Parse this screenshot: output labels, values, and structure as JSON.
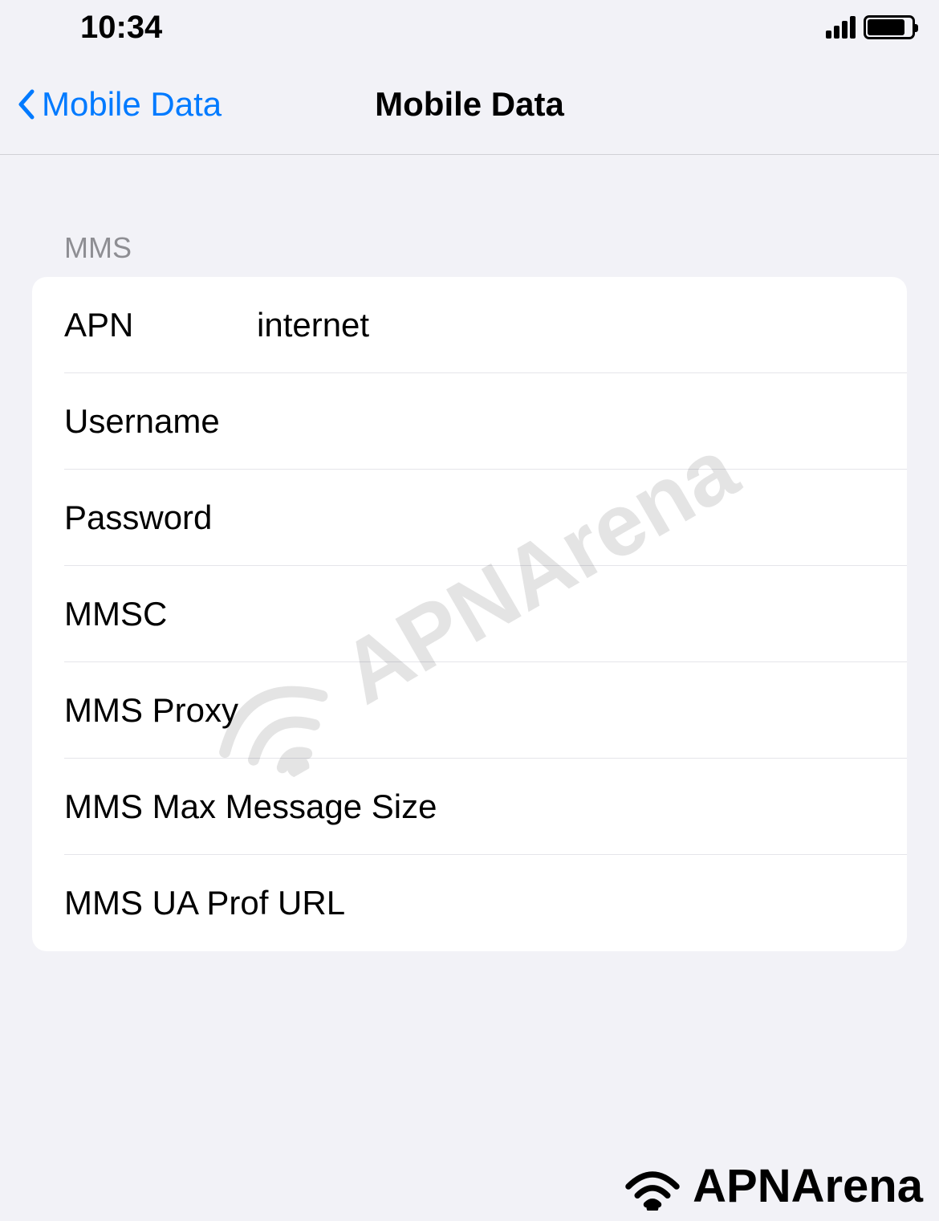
{
  "statusBar": {
    "time": "10:34"
  },
  "nav": {
    "backLabel": "Mobile Data",
    "title": "Mobile Data"
  },
  "section": {
    "header": "MMS",
    "rows": [
      {
        "label": "APN",
        "value": "internet"
      },
      {
        "label": "Username",
        "value": ""
      },
      {
        "label": "Password",
        "value": ""
      },
      {
        "label": "MMSC",
        "value": ""
      },
      {
        "label": "MMS Proxy",
        "value": ""
      },
      {
        "label": "MMS Max Message Size",
        "value": ""
      },
      {
        "label": "MMS UA Prof URL",
        "value": ""
      }
    ]
  },
  "watermark": "APNArena",
  "footer": "APNArena"
}
